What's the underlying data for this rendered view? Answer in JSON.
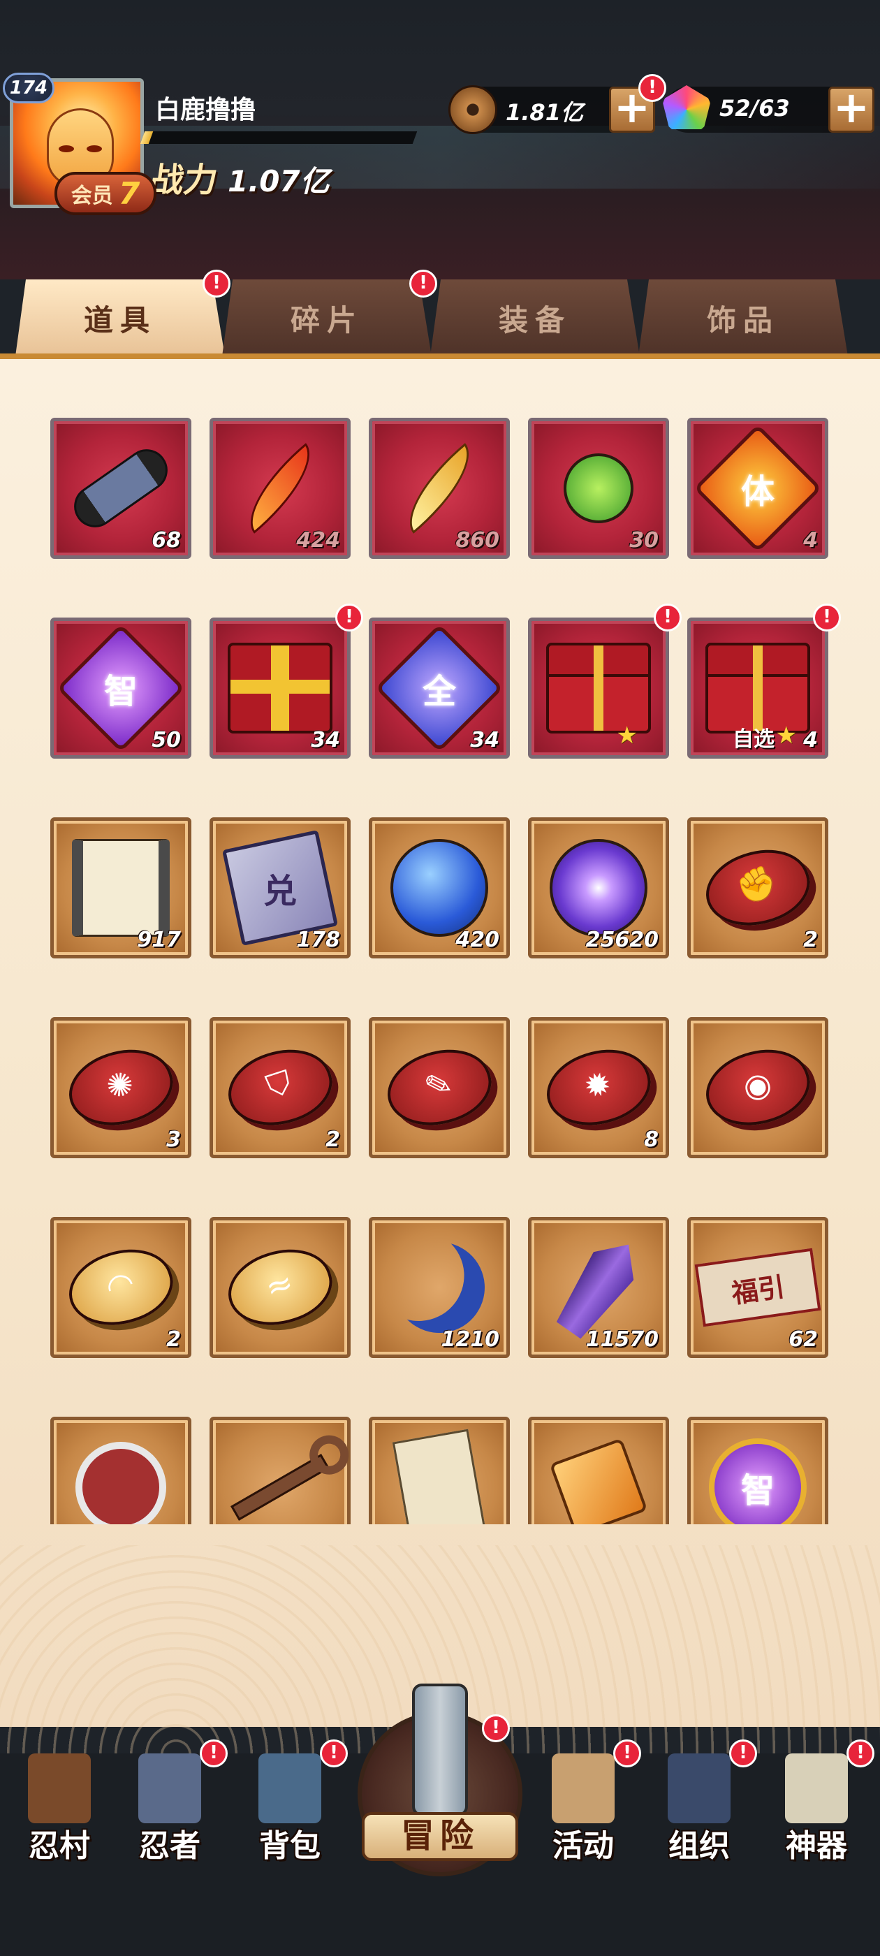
{
  "player": {
    "name": "白鹿撸撸",
    "level": "174",
    "vip_label": "会员",
    "vip_level": "7",
    "power_label": "战力",
    "power_value": "1.07亿",
    "exp_fraction": 0.03
  },
  "currencies": {
    "coins": "1.81亿",
    "gems": "52/63",
    "plus": "+"
  },
  "alert_mark": "!",
  "tabs": [
    {
      "label": "道具",
      "active": true,
      "alert": true
    },
    {
      "label": "碎片",
      "active": false,
      "alert": true
    },
    {
      "label": "装备",
      "active": false,
      "alert": false
    },
    {
      "label": "饰品",
      "active": false,
      "alert": false
    }
  ],
  "items": [
    {
      "icon": "ninja-scroll-icon",
      "qty": "68"
    },
    {
      "icon": "red-feather-icon",
      "qty": "424"
    },
    {
      "icon": "gold-feather-icon",
      "qty": "860"
    },
    {
      "icon": "jade-pendant-icon",
      "qty": "30"
    },
    {
      "icon": "stamina-seal-icon",
      "glyph": "体",
      "qty": "4"
    },
    {
      "icon": "intellect-seal-icon",
      "glyph": "智",
      "qty": "50"
    },
    {
      "icon": "gift-box-icon",
      "qty": "34",
      "alert": true
    },
    {
      "icon": "all-seal-icon",
      "glyph": "全",
      "qty": "34"
    },
    {
      "icon": "red-chest-icon",
      "qty": "",
      "alert": true,
      "star": true
    },
    {
      "icon": "select-chest-icon",
      "tag": "自选",
      "qty": "4",
      "alert": true,
      "star": true
    },
    {
      "icon": "map-scroll-icon",
      "qty": "917"
    },
    {
      "icon": "exchange-paper-icon",
      "glyph": "兑",
      "qty": "178"
    },
    {
      "icon": "blue-orb-icon",
      "qty": "420"
    },
    {
      "icon": "purple-orb-icon",
      "qty": "25620"
    },
    {
      "icon": "fist-stone-icon",
      "qty": "2"
    },
    {
      "icon": "flame-stone-icon",
      "qty": "3"
    },
    {
      "icon": "shield-stone-icon",
      "qty": "2"
    },
    {
      "icon": "brush-stone-icon",
      "qty": ""
    },
    {
      "icon": "burst-stone-icon",
      "qty": "8"
    },
    {
      "icon": "eye-stone-icon",
      "qty": ""
    },
    {
      "icon": "gold-swirl-stone-icon",
      "qty": "2"
    },
    {
      "icon": "gold-wave-stone-icon",
      "qty": ""
    },
    {
      "icon": "blue-moon-icon",
      "qty": "1210"
    },
    {
      "icon": "purple-crystal-icon",
      "qty": "11570"
    },
    {
      "icon": "fortune-banner-icon",
      "glyph": "福引",
      "qty": "62"
    },
    {
      "icon": "shuriken-icon",
      "qty": ""
    },
    {
      "icon": "bronze-key-icon",
      "qty": ""
    },
    {
      "icon": "paper-tag-icon",
      "qty": ""
    },
    {
      "icon": "amber-hammer-icon",
      "qty": ""
    },
    {
      "icon": "intellect-medal-icon",
      "glyph": "智",
      "qty": ""
    }
  ],
  "nav": [
    {
      "label": "忍村",
      "icon": "village-gate-icon",
      "alert": false
    },
    {
      "label": "忍者",
      "icon": "ninja-head-icon",
      "alert": true
    },
    {
      "label": "背包",
      "icon": "backpack-icon",
      "alert": true
    },
    {
      "label": "冒险",
      "icon": "adventure-scroll-icon",
      "alert": true
    },
    {
      "label": "活动",
      "icon": "drum-icon",
      "alert": true
    },
    {
      "label": "组织",
      "icon": "organization-icon",
      "alert": true
    },
    {
      "label": "神器",
      "icon": "artifact-scroll-icon",
      "alert": true
    }
  ]
}
